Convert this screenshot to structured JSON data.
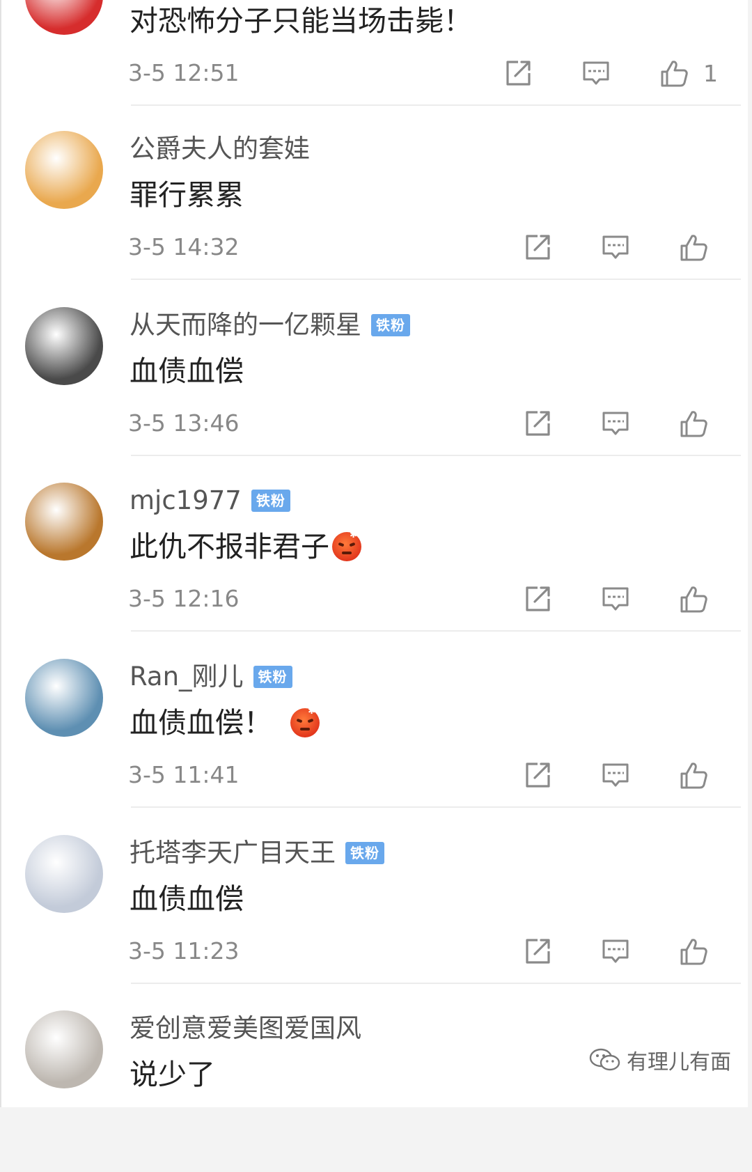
{
  "comments": [
    {
      "username": "",
      "badge": "",
      "text": "对恐怖分子只能当场击毙！",
      "time": "3-5 12:51",
      "likes": "1",
      "avatar_color": "#d62d2d",
      "emoji": false
    },
    {
      "username": "公爵夫人的套娃",
      "badge": "",
      "text": "罪行累累",
      "time": "3-5 14:32",
      "likes": "",
      "avatar_color": "#e9a84e",
      "emoji": false
    },
    {
      "username": "从天而降的一亿颗星",
      "badge": "铁粉",
      "text": "血债血偿",
      "time": "3-5 13:46",
      "likes": "",
      "avatar_color": "#4a4a4a",
      "emoji": false
    },
    {
      "username": "mjc1977",
      "badge": "铁粉",
      "text": "此仇不报非君子",
      "time": "3-5 12:16",
      "likes": "",
      "avatar_color": "#b9772d",
      "emoji": true
    },
    {
      "username": "Ran_刚儿",
      "badge": "铁粉",
      "text": "血债血偿！",
      "time": "3-5 11:41",
      "likes": "",
      "avatar_color": "#5e8fb2",
      "emoji": true
    },
    {
      "username": "托塔李天广目天王",
      "badge": "铁粉",
      "text": "血债血偿",
      "time": "3-5 11:23",
      "likes": "",
      "avatar_color": "#c3cbd9",
      "emoji": false
    },
    {
      "username": "爱创意爱美图爱国风",
      "badge": "",
      "text": "说少了",
      "time": "",
      "likes": "",
      "avatar_color": "#bdb7b0",
      "emoji": false
    }
  ],
  "icons": {
    "repost": "repost-icon",
    "comment": "comment-icon",
    "like": "thumbs-up-icon"
  },
  "watermark": {
    "text": "有理儿有面",
    "icon": "wechat-icon"
  }
}
